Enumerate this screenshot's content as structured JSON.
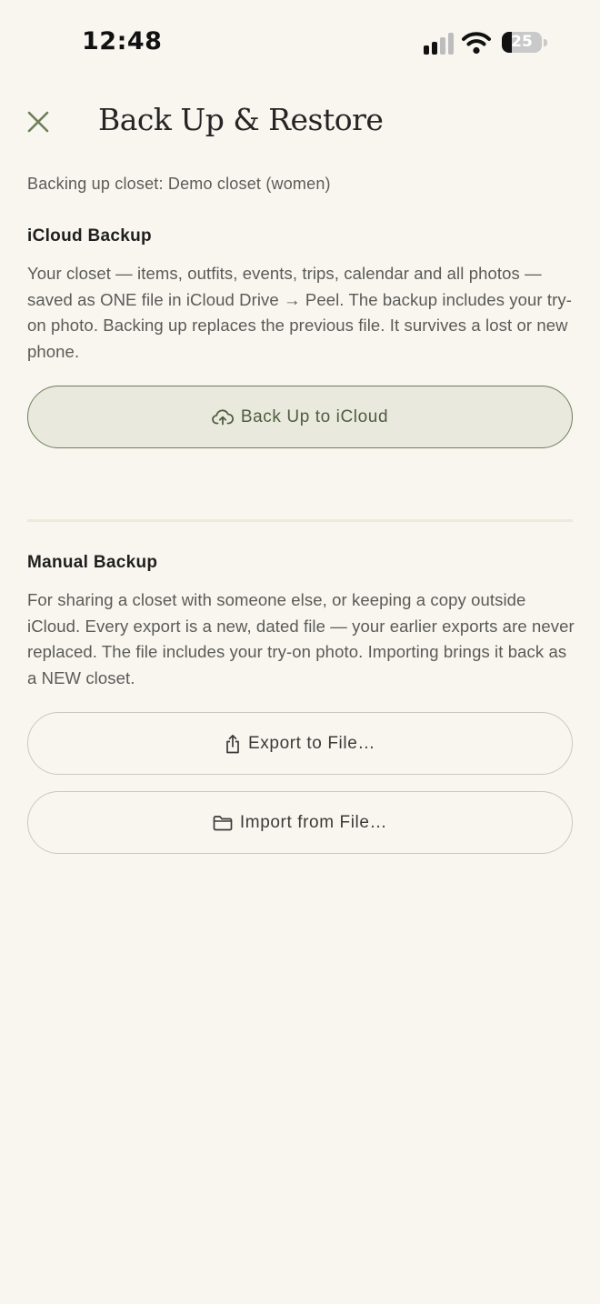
{
  "status_bar": {
    "time": "12:48",
    "battery_level": "25",
    "battery_fraction": 0.25,
    "signal_icon": "cellular-signal-icon",
    "wifi_icon": "wifi-icon"
  },
  "header": {
    "title": "Back Up & Restore",
    "close_icon": "close-icon"
  },
  "subtitle": "Backing up closet: Demo closet (women)",
  "icloud": {
    "heading": "iCloud Backup",
    "description": "Your closet — items, outfits, events, trips, calendar and all photos — saved as ONE file in iCloud Drive → Peel. The backup includes your try-on photo. Backing up replaces the previous file. It survives a lost or new phone.",
    "button_label": "Back Up to iCloud",
    "button_icon": "cloud-upload-icon"
  },
  "manual": {
    "heading": "Manual Backup",
    "description": "For sharing a closet with someone else, or keeping a copy outside iCloud. Every export is a new, dated file — your earlier exports are never replaced. The file includes your try-on photo. Importing brings it back as a NEW closet.",
    "export_label": "Export to File…",
    "export_icon": "share-icon",
    "import_label": "Import from File…",
    "import_icon": "folder-icon"
  },
  "colors": {
    "background": "#F9F6F0",
    "accent": "#6E7F5A",
    "primary_button_fill": "#E9E9DE",
    "divider": "#ECEADB"
  }
}
